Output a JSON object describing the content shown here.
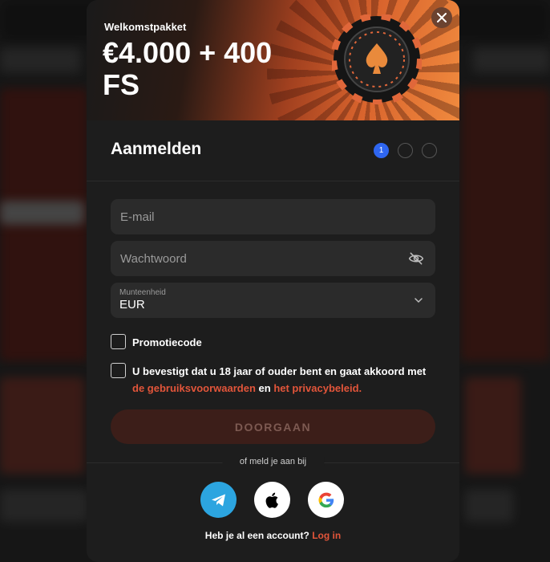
{
  "hero": {
    "subtitle": "Welkomstpakket",
    "title": "€4.000 + 400 FS"
  },
  "form": {
    "title": "Aanmelden",
    "steps": [
      "1",
      "",
      ""
    ],
    "active_step": 1,
    "email_placeholder": "E-mail",
    "password_placeholder": "Wachtwoord",
    "currency_label": "Munteenheid",
    "currency_value": "EUR",
    "promo_label": "Promotiecode",
    "terms_text": "U bevestigt dat u 18 jaar of ouder bent en gaat akkoord met",
    "terms_link": "de gebruiksvoorwaarden",
    "terms_and": "en",
    "privacy_link": "het privacybeleid.",
    "submit_label": "DOORGAAN"
  },
  "social": {
    "divider_text": "of meld je aan bij",
    "providers": [
      "telegram-icon",
      "apple-icon",
      "google-icon"
    ]
  },
  "footer": {
    "question": "Heb je al een account?",
    "login_link": "Log in"
  },
  "colors": {
    "accent": "#e2553a",
    "step_active": "#2f66f0",
    "telegram": "#2ca5e0"
  }
}
